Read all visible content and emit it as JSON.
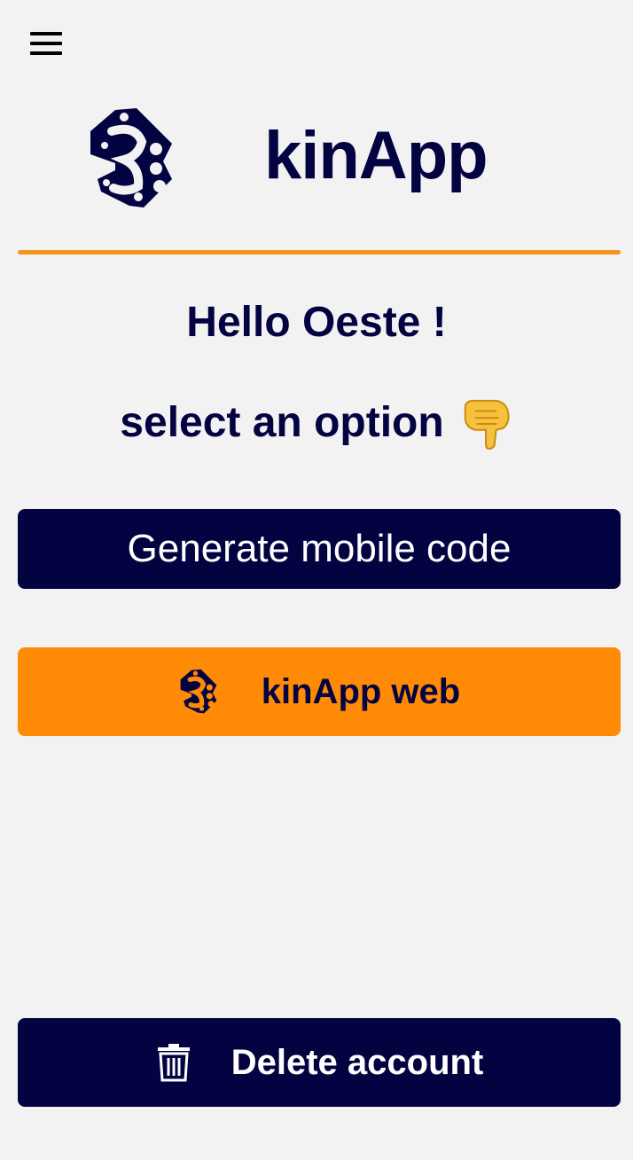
{
  "header": {
    "menu_icon": "hamburger-menu-icon",
    "logo_icon": "kinapp-logo-icon",
    "app_title": "kinApp"
  },
  "colors": {
    "brand_navy": "#030341",
    "brand_orange": "#ff8a05",
    "divider_orange": "#f7941d",
    "background": "#f2f2f2"
  },
  "main": {
    "greeting": "Hello Oeste !",
    "prompt": "select an option",
    "prompt_icon": "pointing-down-hand-icon"
  },
  "buttons": {
    "generate_label": "Generate mobile code",
    "web_label": "kinApp web",
    "web_icon": "kinapp-logo-icon",
    "delete_label": "Delete account",
    "delete_icon": "trash-icon"
  }
}
